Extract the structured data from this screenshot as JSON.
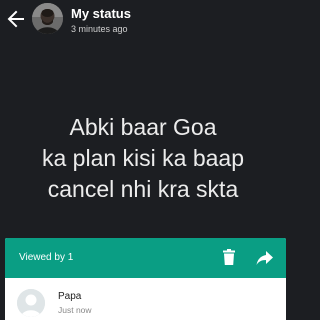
{
  "colors": {
    "background": "#1c1e22",
    "accent": "#0a9e84",
    "panel": "#ffffff"
  },
  "header": {
    "title": "My status",
    "subtitle": "3 minutes ago",
    "back_icon": "arrow-left-icon",
    "avatar": "profile-photo"
  },
  "status": {
    "lines": [
      "Abki baar Goa",
      "ka plan kisi ka baap",
      "cancel nhi kra skta"
    ]
  },
  "viewers": {
    "label": "Viewed by 1",
    "delete_icon": "trash-icon",
    "forward_icon": "forward-icon",
    "list": [
      {
        "name": "Papa",
        "time": "Just now",
        "avatar": "default-avatar-icon"
      }
    ]
  }
}
